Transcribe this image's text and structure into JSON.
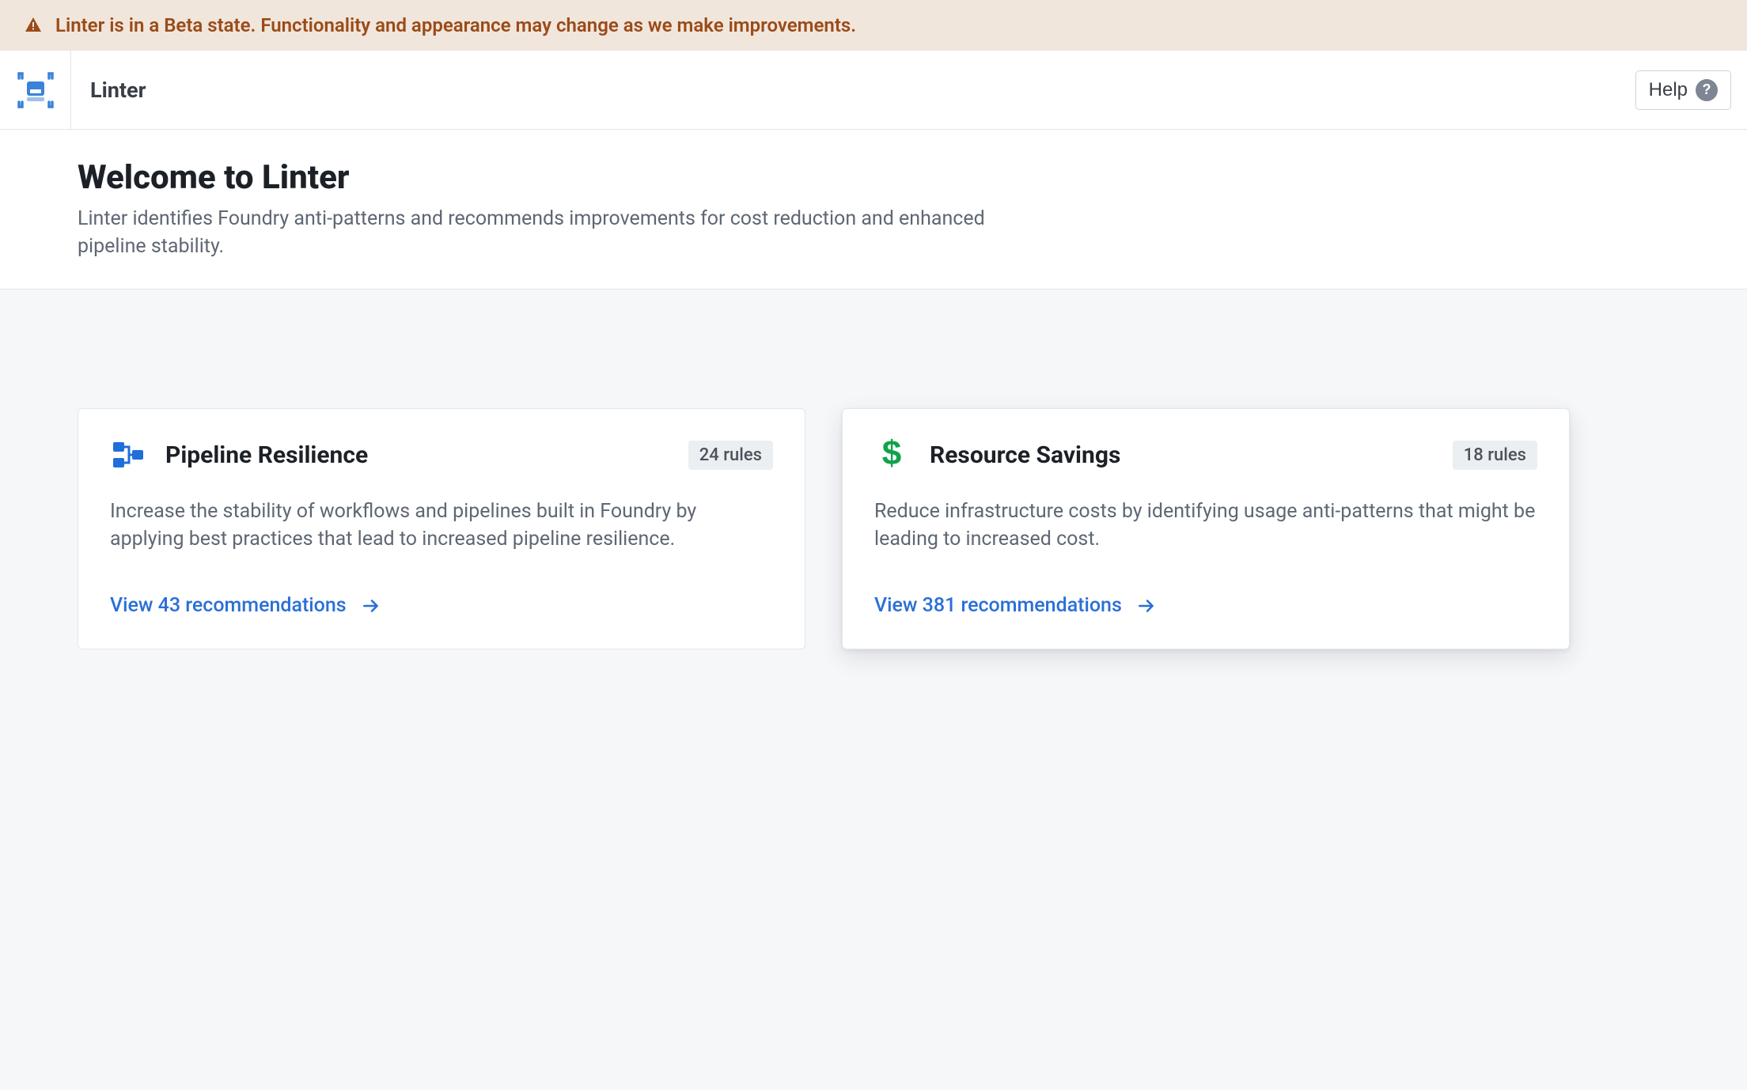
{
  "banner": {
    "message": "Linter is in a Beta state. Functionality and appearance may change as we make improvements."
  },
  "header": {
    "title": "Linter",
    "help_label": "Help"
  },
  "hero": {
    "title": "Welcome to Linter",
    "description": "Linter identifies Foundry anti-patterns and recommends improvements for cost reduction and enhanced pipeline stability."
  },
  "cards": [
    {
      "icon": "pipeline-icon",
      "title": "Pipeline Resilience",
      "rules_label": "24 rules",
      "description": "Increase the stability of workflows and pipelines built in Foundry by applying best practices that lead to increased pipeline resilience.",
      "link_label": "View 43 recommendations"
    },
    {
      "icon": "dollar-icon",
      "title": "Resource Savings",
      "rules_label": "18 rules",
      "description": "Reduce infrastructure costs by identifying usage anti-patterns that might be leading to increased cost.",
      "link_label": "View 381 recommendations"
    }
  ],
  "colors": {
    "warning": "#9a4b18",
    "link": "#2a6fd6",
    "pipeline_icon": "#1e6fd9",
    "dollar_icon": "#10a34a"
  }
}
